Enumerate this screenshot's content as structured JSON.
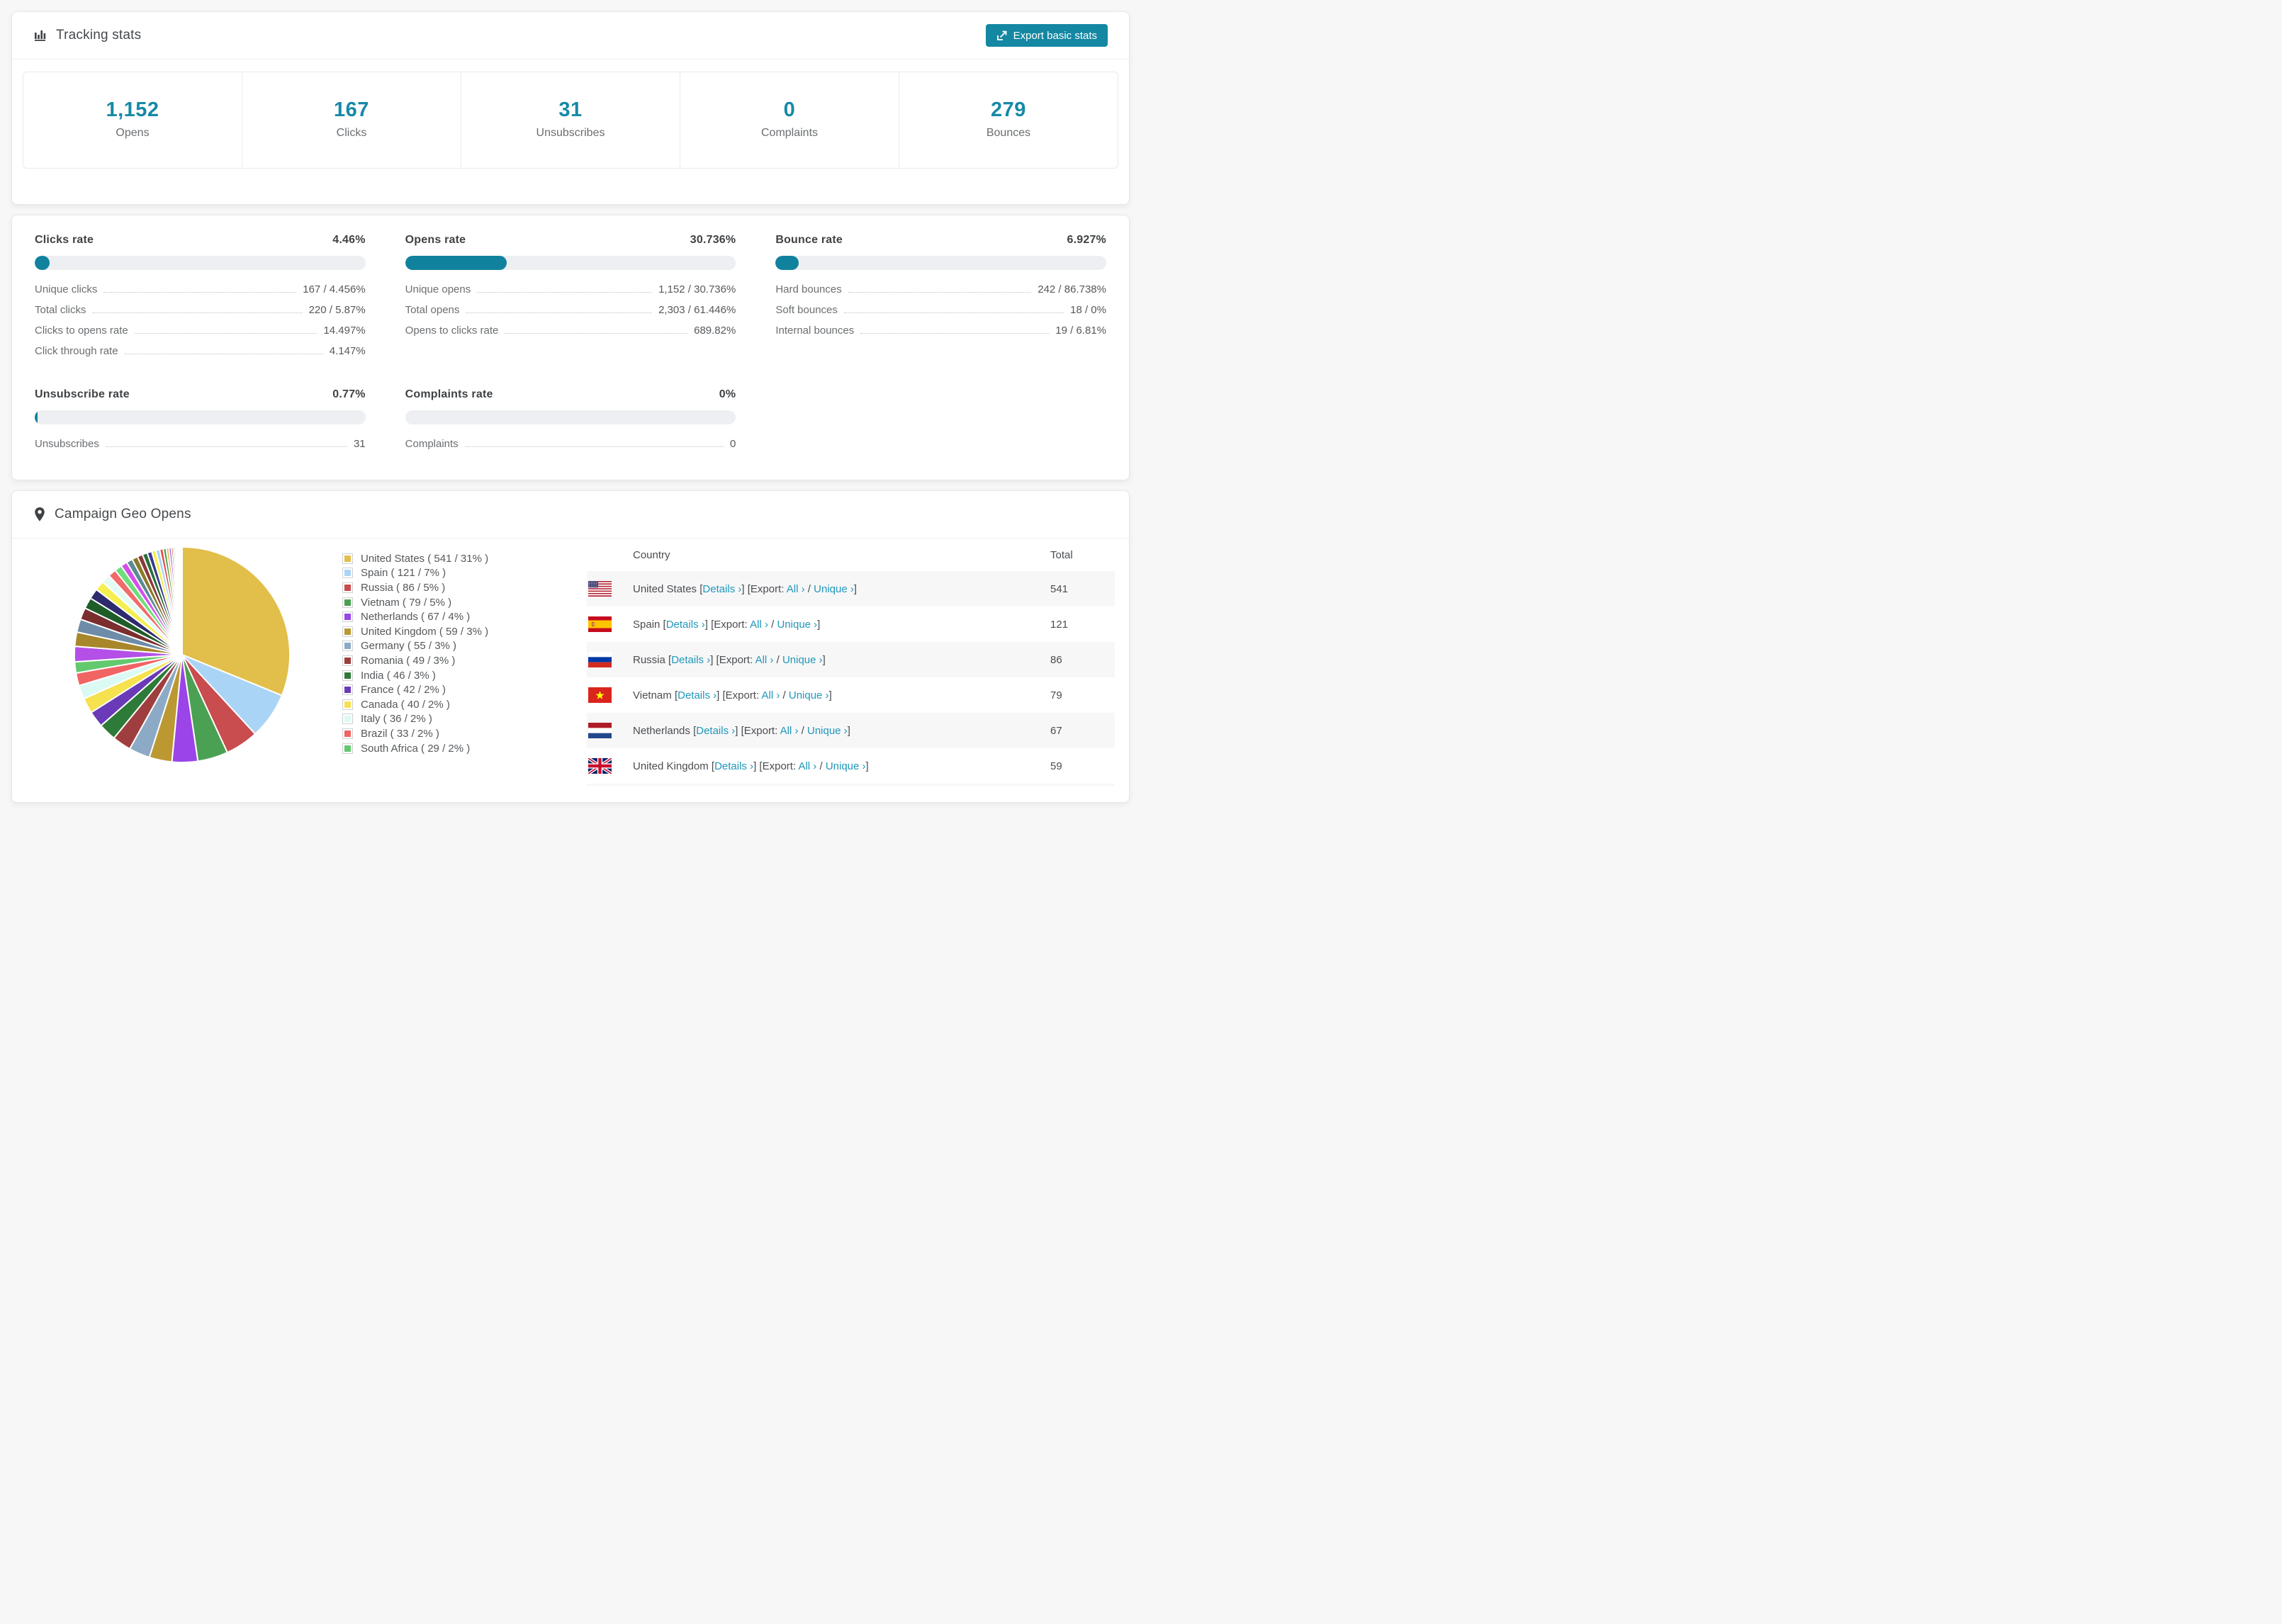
{
  "tracking": {
    "title": "Tracking stats",
    "export_button": "Export basic stats",
    "stats": [
      {
        "value": "1,152",
        "label": "Opens"
      },
      {
        "value": "167",
        "label": "Clicks"
      },
      {
        "value": "31",
        "label": "Unsubscribes"
      },
      {
        "value": "0",
        "label": "Complaints"
      },
      {
        "value": "279",
        "label": "Bounces"
      }
    ]
  },
  "rates": {
    "clicks": {
      "title": "Clicks rate",
      "value": "4.46%",
      "percent": 4.46,
      "rows": [
        {
          "label": "Unique clicks",
          "value": "167 / 4.456%"
        },
        {
          "label": "Total clicks",
          "value": "220 / 5.87%"
        },
        {
          "label": "Clicks to opens rate",
          "value": "14.497%"
        },
        {
          "label": "Click through rate",
          "value": "4.147%"
        }
      ]
    },
    "opens": {
      "title": "Opens rate",
      "value": "30.736%",
      "percent": 30.736,
      "rows": [
        {
          "label": "Unique opens",
          "value": "1,152 / 30.736%"
        },
        {
          "label": "Total opens",
          "value": "2,303 / 61.446%"
        },
        {
          "label": "Opens to clicks rate",
          "value": "689.82%"
        }
      ]
    },
    "bounce": {
      "title": "Bounce rate",
      "value": "6.927%",
      "percent": 6.927,
      "rows": [
        {
          "label": "Hard bounces",
          "value": "242 / 86.738%"
        },
        {
          "label": "Soft bounces",
          "value": "18 / 0%"
        },
        {
          "label": "Internal bounces",
          "value": "19 / 6.81%"
        }
      ]
    },
    "unsubscribe": {
      "title": "Unsubscribe rate",
      "value": "0.77%",
      "percent": 0.77,
      "rows": [
        {
          "label": "Unsubscribes",
          "value": "31"
        }
      ]
    },
    "complaints": {
      "title": "Complaints rate",
      "value": "0%",
      "percent": 0,
      "rows": [
        {
          "label": "Complaints",
          "value": "0"
        }
      ]
    }
  },
  "geo": {
    "title": "Campaign Geo Opens",
    "legend": [
      {
        "label": "United States ( 541 / 31% )",
        "color": "#e2bf4b"
      },
      {
        "label": "Spain ( 121 / 7% )",
        "color": "#aad4f5"
      },
      {
        "label": "Russia ( 86 / 5% )",
        "color": "#c94c4e"
      },
      {
        "label": "Vietnam ( 79 / 5% )",
        "color": "#4ba153"
      },
      {
        "label": "Netherlands ( 67 / 4% )",
        "color": "#9b44e8"
      },
      {
        "label": "United Kingdom ( 59 / 3% )",
        "color": "#bb9832"
      },
      {
        "label": "Germany ( 55 / 3% )",
        "color": "#8caac6"
      },
      {
        "label": "Romania ( 49 / 3% )",
        "color": "#9e3e3e"
      },
      {
        "label": "India ( 46 / 3% )",
        "color": "#2e7a38"
      },
      {
        "label": "France ( 42 / 2% )",
        "color": "#6a3ab8"
      },
      {
        "label": "Canada ( 40 / 2% )",
        "color": "#f6e14e"
      },
      {
        "label": "Italy ( 36 / 2% )",
        "color": "#dbfaf4"
      },
      {
        "label": "Brazil ( 33 / 2% )",
        "color": "#f16464"
      },
      {
        "label": "South Africa ( 29 / 2% )",
        "color": "#62c96e"
      }
    ],
    "table": {
      "headers": [
        "Country",
        "Total"
      ],
      "link_labels": {
        "open_bracket": "[",
        "close_bracket": "]",
        "details": "Details ›",
        "export_label": "Export:",
        "all": "All ›",
        "slash": "/",
        "unique": "Unique ›"
      },
      "rows": [
        {
          "flag": "us",
          "country": "United States",
          "total": "541"
        },
        {
          "flag": "es",
          "country": "Spain",
          "total": "121"
        },
        {
          "flag": "ru",
          "country": "Russia",
          "total": "86"
        },
        {
          "flag": "vn",
          "country": "Vietnam",
          "total": "79"
        },
        {
          "flag": "nl",
          "country": "Netherlands",
          "total": "67"
        },
        {
          "flag": "gb",
          "country": "United Kingdom",
          "total": "59"
        },
        {
          "flag": "de",
          "country": "",
          "total": "",
          "partial": true
        }
      ]
    }
  },
  "chart_data": {
    "type": "pie",
    "title": "Campaign Geo Opens",
    "legend_position": "right",
    "start_angle": "top",
    "direction": "clockwise",
    "labels": [
      "United States",
      "Spain",
      "Russia",
      "Vietnam",
      "Netherlands",
      "United Kingdom",
      "Germany",
      "Romania",
      "India",
      "France",
      "Canada",
      "Italy",
      "Brazil",
      "South Africa"
    ],
    "values": [
      541,
      121,
      86,
      79,
      67,
      59,
      55,
      49,
      46,
      42,
      40,
      36,
      33,
      29
    ],
    "percent_labels": [
      31,
      7,
      5,
      5,
      4,
      3,
      3,
      3,
      3,
      2,
      2,
      2,
      2,
      2
    ],
    "colors": [
      "#e2bf4b",
      "#aad4f5",
      "#c94c4e",
      "#4ba153",
      "#9b44e8",
      "#bb9832",
      "#8caac6",
      "#9e3e3e",
      "#2e7a38",
      "#6a3ab8",
      "#f6e14e",
      "#dbfaf4",
      "#f16464",
      "#62c96e"
    ],
    "other_slices": {
      "note": "many small unlabeled country slices, together roughly a quarter of the pie, decreasing to hairline slivers",
      "values": [
        40,
        37,
        34,
        31,
        29,
        27,
        25,
        23,
        21,
        19,
        17,
        16,
        15,
        14,
        13,
        12,
        11,
        10,
        9,
        8,
        7,
        6,
        5,
        4.5,
        4,
        3.5,
        3,
        2.5,
        2,
        1.5,
        1.2,
        1
      ],
      "colors": [
        "#b44fe8",
        "#a8862a",
        "#6e8ca8",
        "#7a2e2e",
        "#1e5c28",
        "#2e2a6e",
        "#f4ef4e",
        "#e4fbf4",
        "#f26a6a",
        "#6ede7a",
        "#d44fe8",
        "#5a8a96",
        "#8a7a2a",
        "#8a3a3a",
        "#2a6e3a",
        "#3a3a8e",
        "#f4ef4e",
        "#a8d4f2",
        "#e84a4c",
        "#4aa153",
        "#e2bf4b",
        "#9b44e8",
        "#c94c4e",
        "#62c96e",
        "#aad4f5",
        "#bb9832",
        "#6a3ab8",
        "#f16464",
        "#8caac6",
        "#2e7a38",
        "#d44fe8",
        "#e2bf4b"
      ]
    }
  },
  "theme": {
    "accent_teal": "#1487a2",
    "number_teal": "#1689a6",
    "bar_fill": "#10829e",
    "link_teal": "#2097ba",
    "page_bg": "#f7f7f8"
  }
}
